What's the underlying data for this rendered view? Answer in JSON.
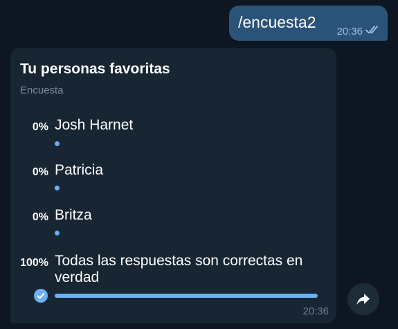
{
  "outgoing_message": {
    "text": "/encuesta2",
    "time": "20:36",
    "status_icon": "double-check-icon"
  },
  "poll": {
    "title": "Tu personas favoritas",
    "type_label": "Encuesta",
    "time": "20:36",
    "options": [
      {
        "percent": "0%",
        "label": "Josh Harnet",
        "fraction": 0,
        "chosen": false
      },
      {
        "percent": "0%",
        "label": "Patricia",
        "fraction": 0,
        "chosen": false
      },
      {
        "percent": "0%",
        "label": "Britza",
        "fraction": 0,
        "chosen": false
      },
      {
        "percent": "100%",
        "label": "Todas las respuestas son correctas en verdad",
        "fraction": 1,
        "chosen": true
      }
    ]
  },
  "share_button": {
    "icon": "share-arrow-icon"
  },
  "colors": {
    "background": "#0e1621",
    "outgoing_bubble": "#2b5278",
    "incoming_bubble": "#182533",
    "accent": "#6ab2f2"
  }
}
